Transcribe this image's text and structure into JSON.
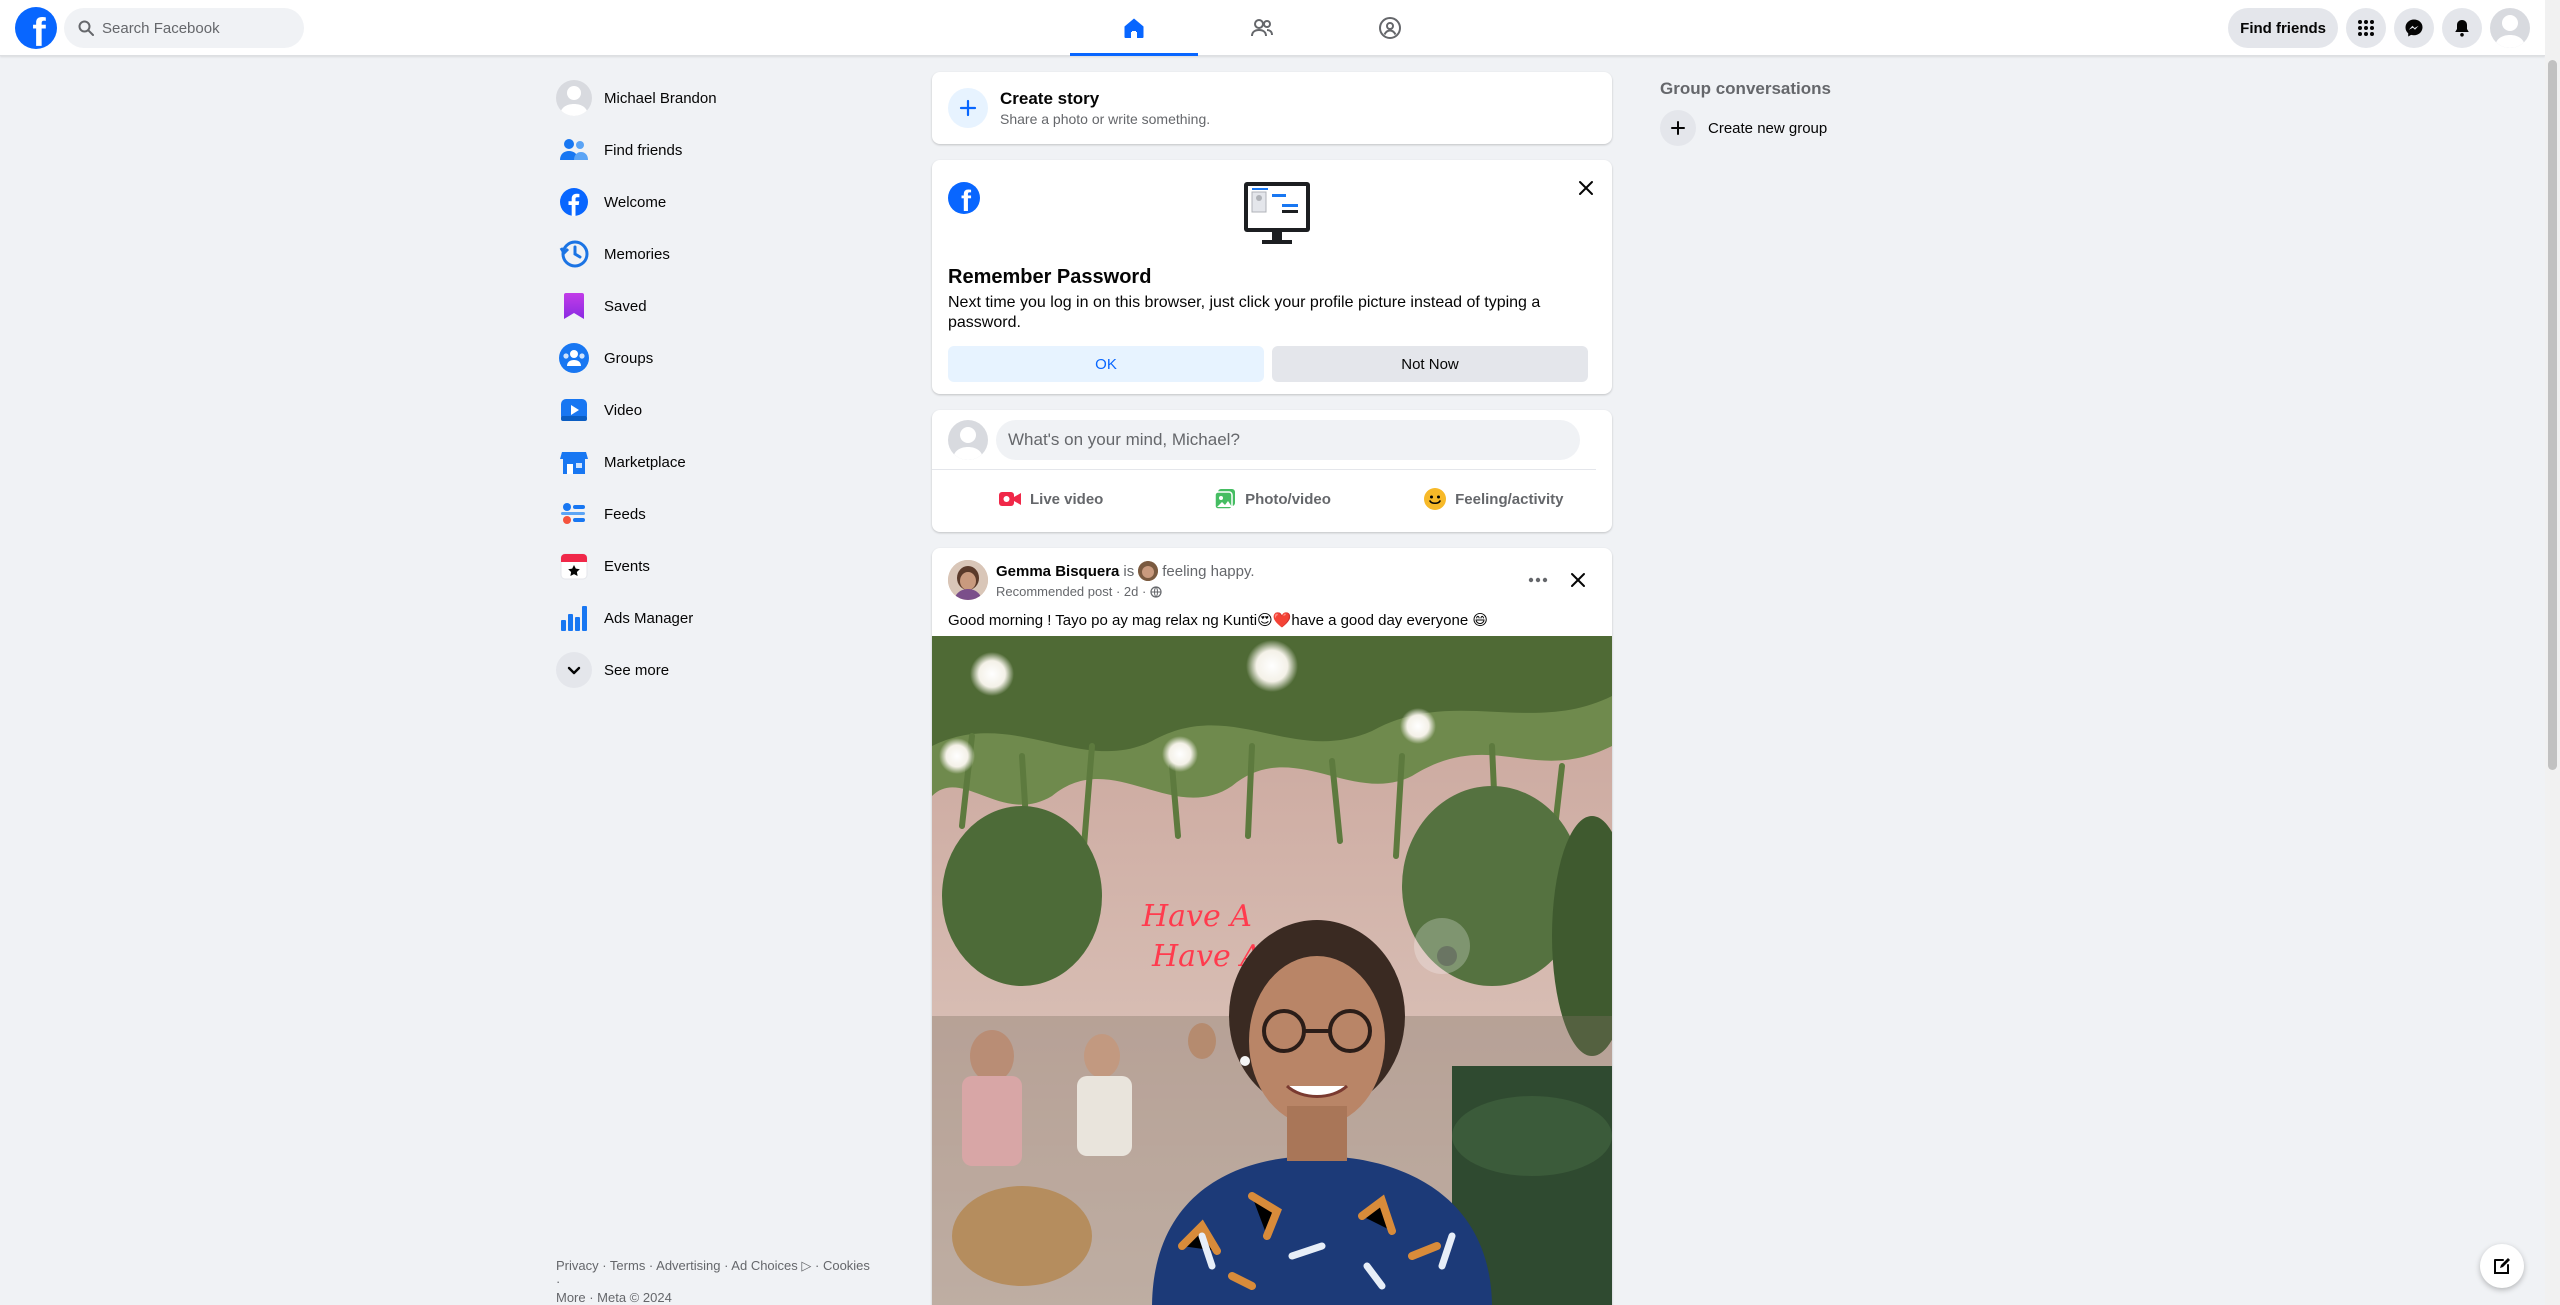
{
  "topbar": {
    "logo_letter": "f",
    "search_placeholder": "Search Facebook",
    "find_friends_label": "Find friends"
  },
  "sidebar": {
    "items": [
      {
        "label": "Michael Brandon",
        "icon": "profile-avatar"
      },
      {
        "label": "Find friends",
        "icon": "friends-icon"
      },
      {
        "label": "Welcome",
        "icon": "facebook-icon"
      },
      {
        "label": "Memories",
        "icon": "clock-icon"
      },
      {
        "label": "Saved",
        "icon": "bookmark-icon"
      },
      {
        "label": "Groups",
        "icon": "groups-icon"
      },
      {
        "label": "Video",
        "icon": "video-icon"
      },
      {
        "label": "Marketplace",
        "icon": "marketplace-icon"
      },
      {
        "label": "Feeds",
        "icon": "feeds-icon"
      },
      {
        "label": "Events",
        "icon": "calendar-icon"
      },
      {
        "label": "Ads Manager",
        "icon": "bar-chart-icon"
      },
      {
        "label": "See more",
        "icon": "chevron-down-icon"
      }
    ],
    "footer_line1": "Privacy · Terms · Advertising · Ad Choices ▷ · Cookies ·",
    "footer_line2": "More · Meta © 2024"
  },
  "story": {
    "title": "Create story",
    "subtitle": "Share a photo or write something."
  },
  "remember": {
    "title": "Remember Password",
    "body": "Next time you log in on this browser, just click your profile picture instead of typing a password.",
    "ok_label": "OK",
    "not_now_label": "Not Now"
  },
  "composer": {
    "placeholder": "What's on your mind, Michael?",
    "live_label": "Live video",
    "photo_label": "Photo/video",
    "feeling_label": "Feeling/activity"
  },
  "post": {
    "author": "Gemma Bisquera",
    "is_text": "is",
    "feeling": "feeling happy.",
    "meta": "Recommended post · 2d ·",
    "text": "Good morning ! Tayo po ay mag relax ng Kunti😍❤️have a good day everyone 😄",
    "neon_text": "Have A"
  },
  "rightcol": {
    "title": "Group conversations",
    "create_group_label": "Create new group"
  },
  "colors": {
    "brand": "#0866ff",
    "background": "#f0f2f5"
  }
}
